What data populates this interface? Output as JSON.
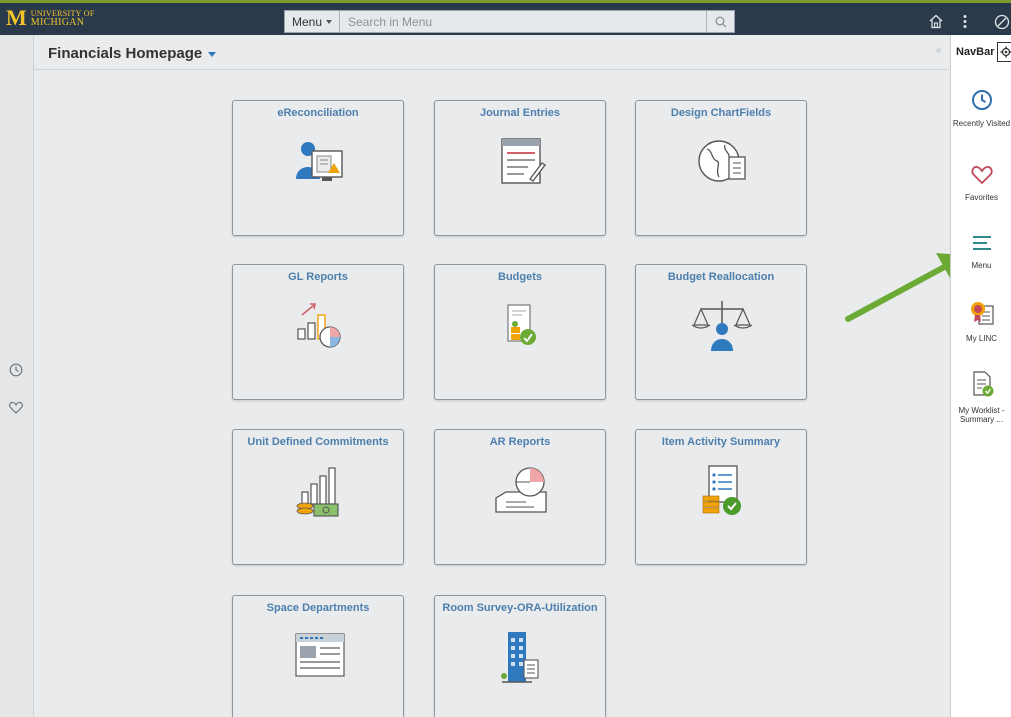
{
  "brand": {
    "logo_letter": "M",
    "line1": "UNIVERSITY OF",
    "line2": "MICHIGAN"
  },
  "search": {
    "menu_label": "Menu",
    "placeholder": "Search in Menu"
  },
  "header": {
    "title": "Financials Homepage"
  },
  "tiles": [
    {
      "label": "eReconciliation",
      "icon": "ereconciliation-icon"
    },
    {
      "label": "Journal Entries",
      "icon": "journal-entries-icon"
    },
    {
      "label": "Design ChartFields",
      "icon": "globe-document-icon"
    },
    {
      "label": "GL Reports",
      "icon": "gl-reports-chart-icon"
    },
    {
      "label": "Budgets",
      "icon": "budgets-icon"
    },
    {
      "label": "Budget Reallocation",
      "icon": "scale-icon"
    },
    {
      "label": "Unit Defined Commitments",
      "icon": "commitments-icon"
    },
    {
      "label": "AR Reports",
      "icon": "ar-reports-icon"
    },
    {
      "label": "Item Activity Summary",
      "icon": "item-activity-icon"
    },
    {
      "label": "Space Departments",
      "icon": "newspaper-icon"
    },
    {
      "label": "Room Survey-ORA-Utilization",
      "icon": "building-icon"
    }
  ],
  "navbar": {
    "title": "NavBar",
    "items": [
      {
        "label": "Recently Visited",
        "icon": "clock-icon"
      },
      {
        "label": "Favorites",
        "icon": "heart-icon"
      },
      {
        "label": "Menu",
        "icon": "menu-lines-icon"
      },
      {
        "label": "My LINC",
        "icon": "badge-icon"
      },
      {
        "label": "My Worklist -",
        "label2": "Summary ...",
        "icon": "worklist-icon"
      }
    ]
  },
  "colors": {
    "topbar": "#2b3a4b",
    "tile_title": "#4d7fae",
    "arrow": "#6aaa35",
    "brand": "#f3c428"
  }
}
